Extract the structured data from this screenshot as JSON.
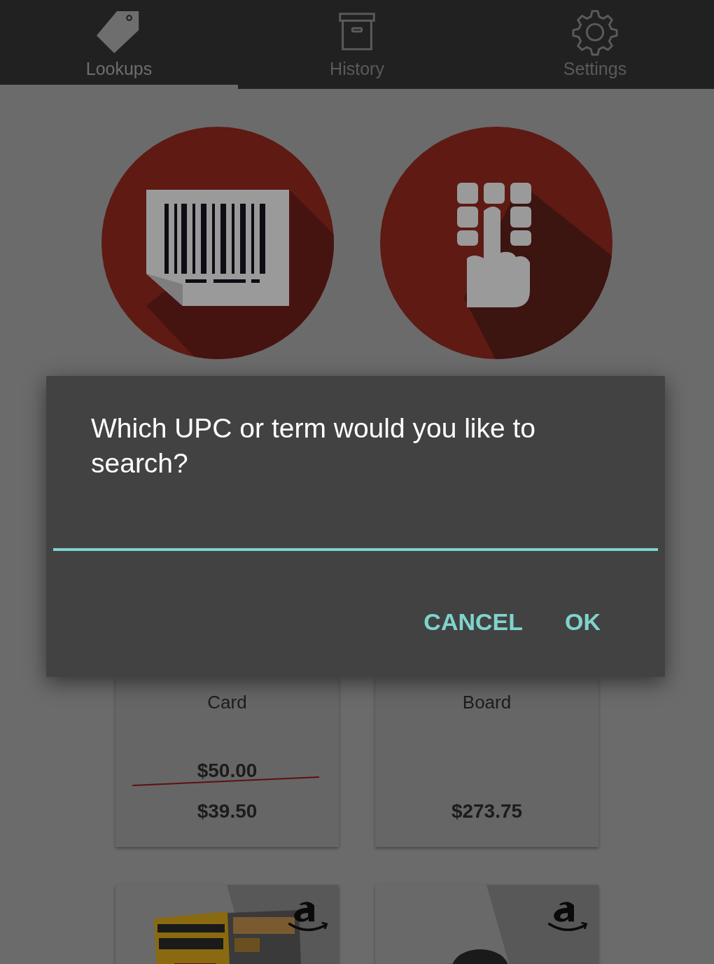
{
  "tabs": [
    {
      "label": "Lookups",
      "selected": true
    },
    {
      "label": "History",
      "selected": false
    },
    {
      "label": "Settings",
      "selected": false
    }
  ],
  "dialog": {
    "message": "Which UPC or term would you like to search?",
    "buttons": [
      "CANCEL",
      "OK"
    ]
  },
  "deals": [
    {
      "title": "Card",
      "original_price": "$50.00",
      "price": "$39.50"
    },
    {
      "title": "Board",
      "price": "$273.75"
    }
  ]
}
